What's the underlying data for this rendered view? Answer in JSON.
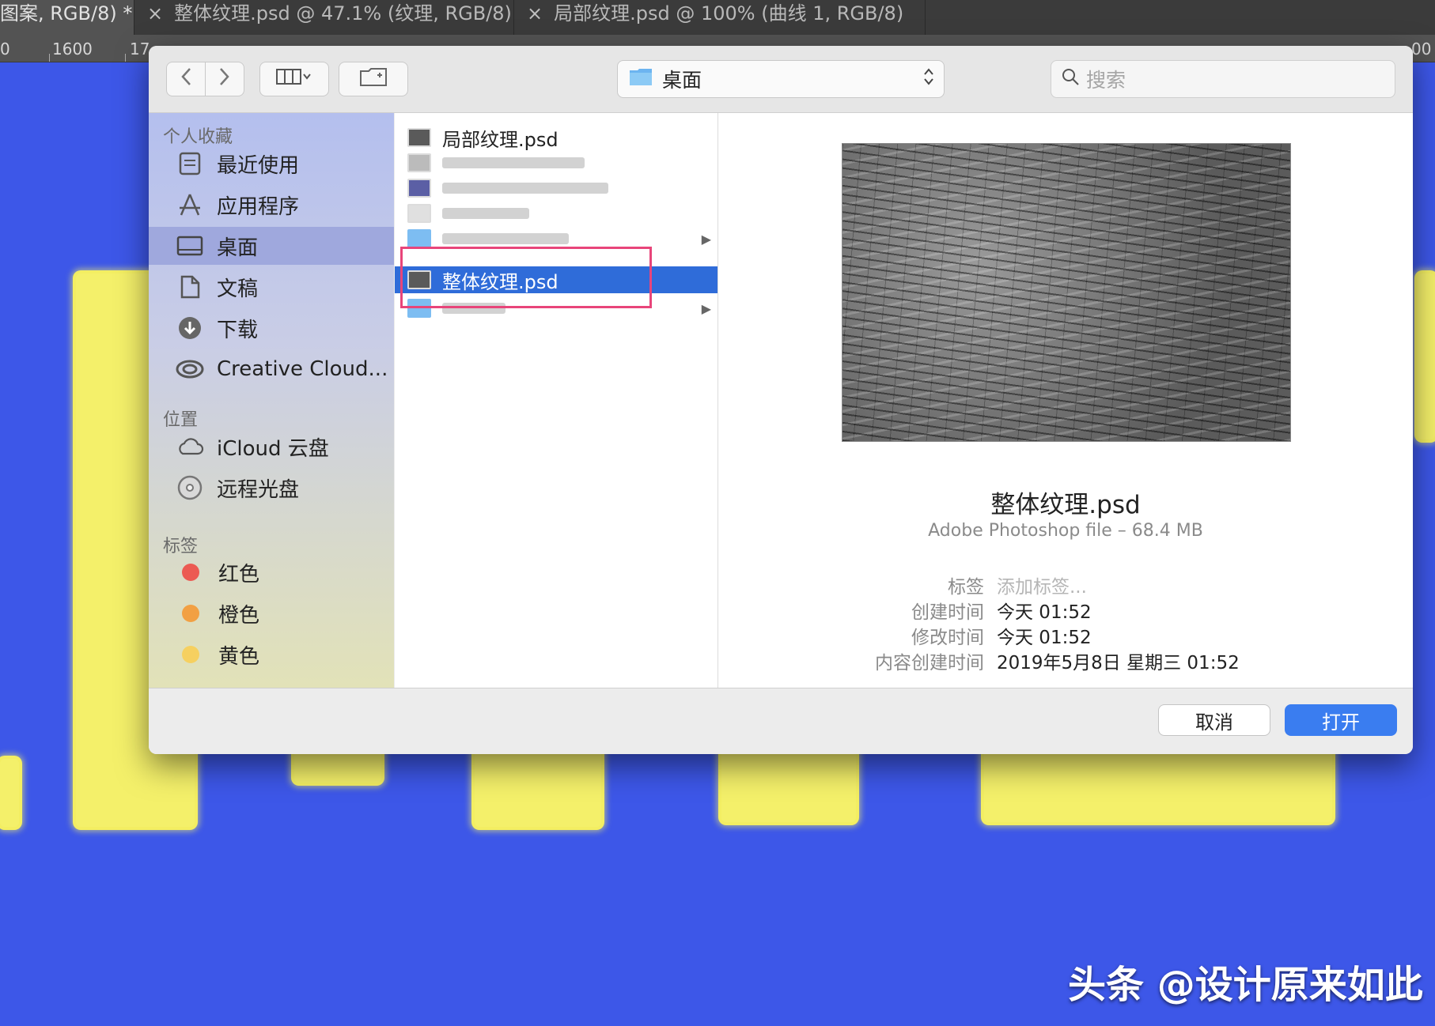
{
  "photoshop": {
    "tabs": [
      {
        "label": "图案, RGB/8) *"
      },
      {
        "close": "×",
        "label": "整体纹理.psd @ 47.1% (纹理, RGB/8)"
      },
      {
        "close": "×",
        "label": "局部纹理.psd @ 100% (曲线 1, RGB/8)"
      }
    ],
    "ruler": [
      "0",
      "1600",
      "17",
      "00"
    ]
  },
  "dialog": {
    "toolbar": {
      "back_icon": "chevron-left-icon",
      "forward_icon": "chevron-right-icon",
      "view_icon": "column-view-icon",
      "new_folder_icon": "new-folder-icon",
      "location": "桌面",
      "search_placeholder": "搜索"
    },
    "sidebar": {
      "favorites_header": "个人收藏",
      "favorites": [
        {
          "label": "最近使用",
          "icon": "recents-icon"
        },
        {
          "label": "应用程序",
          "icon": "applications-icon"
        },
        {
          "label": "桌面",
          "icon": "desktop-icon",
          "selected": true
        },
        {
          "label": "文稿",
          "icon": "documents-icon"
        },
        {
          "label": "下载",
          "icon": "downloads-icon"
        },
        {
          "label": "Creative Cloud...",
          "icon": "creative-cloud-icon"
        }
      ],
      "locations_header": "位置",
      "locations": [
        {
          "label": "iCloud 云盘",
          "icon": "icloud-icon"
        },
        {
          "label": "远程光盘",
          "icon": "remote-disc-icon"
        }
      ],
      "tags_header": "标签",
      "tags": [
        {
          "label": "红色",
          "color": "#ec5a52"
        },
        {
          "label": "橙色",
          "color": "#f2a043"
        },
        {
          "label": "黄色",
          "color": "#f6d060"
        }
      ]
    },
    "files": [
      {
        "name": "局部纹理.psd"
      },
      {
        "name": "整体纹理.psd",
        "selected": true
      }
    ],
    "preview": {
      "name": "整体纹理.psd",
      "kind": "Adobe Photoshop file – 68.4 MB",
      "meta": [
        {
          "key": "标签",
          "value": "添加标签..."
        },
        {
          "key": "创建时间",
          "value": "今天 01:52"
        },
        {
          "key": "修改时间",
          "value": "今天 01:52"
        },
        {
          "key": "内容创建时间",
          "value": "2019年5月8日 星期三 01:52"
        }
      ]
    },
    "footer": {
      "cancel": "取消",
      "open": "打开"
    }
  },
  "watermark": "头条 @设计原来如此",
  "colors": {
    "canvas": "#3d57e8",
    "brush": "#f4f06a",
    "selection": "#2f6cd9",
    "highlight": "#e8457a",
    "open_button": "#3a7df0"
  }
}
